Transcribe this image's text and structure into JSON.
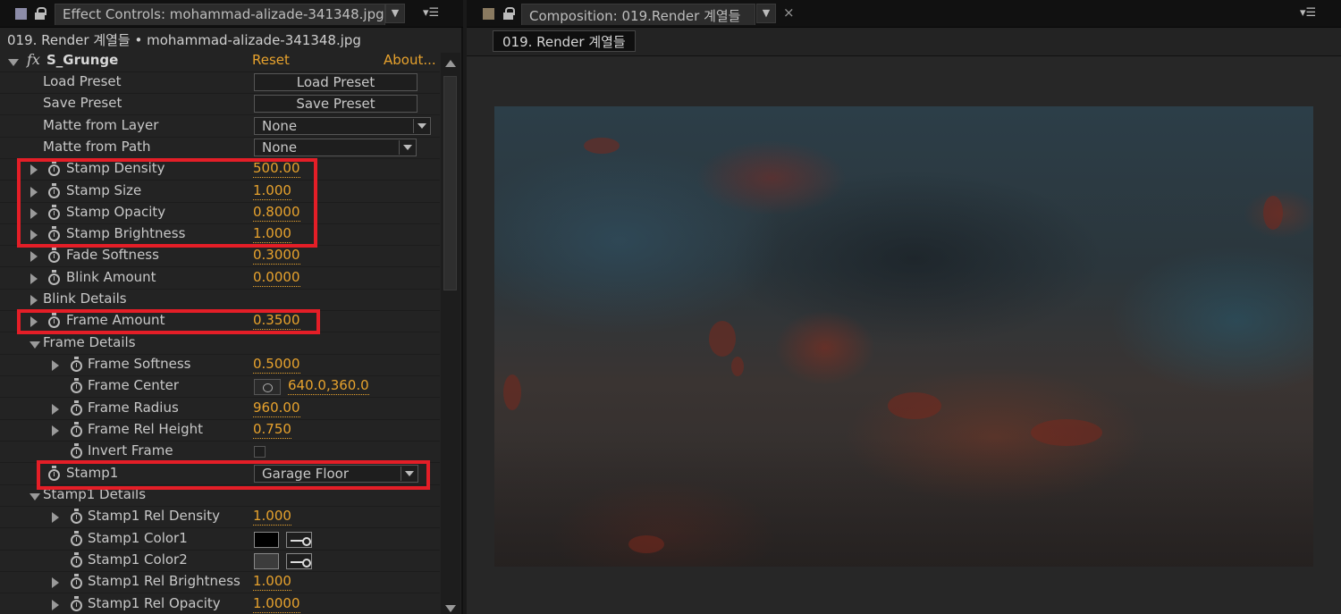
{
  "left_panel": {
    "tab_title": "Effect Controls: mohammad-alizade-341348.jpg",
    "layer_path": "019. Render 계열들 • mohammad-alizade-341348.jpg",
    "effect": {
      "name": "S_Grunge",
      "reset": "Reset",
      "about": "About..."
    },
    "rows": {
      "load_preset": {
        "label": "Load Preset",
        "button": "Load Preset"
      },
      "save_preset": {
        "label": "Save Preset",
        "button": "Save Preset"
      },
      "matte_from_layer": {
        "label": "Matte from Layer",
        "value": "None"
      },
      "matte_from_path": {
        "label": "Matte from Path",
        "value": "None"
      },
      "stamp_density": {
        "label": "Stamp Density",
        "value": "500.00"
      },
      "stamp_size": {
        "label": "Stamp Size",
        "value": "1.000"
      },
      "stamp_opacity": {
        "label": "Stamp Opacity",
        "value": "0.8000"
      },
      "stamp_brightness": {
        "label": "Stamp Brightness",
        "value": "1.000"
      },
      "fade_softness": {
        "label": "Fade Softness",
        "value": "0.3000"
      },
      "blink_amount": {
        "label": "Blink Amount",
        "value": "0.0000"
      },
      "blink_details": {
        "label": "Blink Details"
      },
      "frame_amount": {
        "label": "Frame Amount",
        "value": "0.3500"
      },
      "frame_details": {
        "label": "Frame Details"
      },
      "frame_softness": {
        "label": "Frame Softness",
        "value": "0.5000"
      },
      "frame_center": {
        "label": "Frame Center",
        "value": "640.0,360.0"
      },
      "frame_radius": {
        "label": "Frame Radius",
        "value": "960.00"
      },
      "frame_rel_height": {
        "label": "Frame Rel Height",
        "value": "0.750"
      },
      "invert_frame": {
        "label": "Invert Frame",
        "checked": false
      },
      "stamp1": {
        "label": "Stamp1",
        "value": "Garage Floor"
      },
      "stamp1_details": {
        "label": "Stamp1 Details"
      },
      "stamp1_rel_density": {
        "label": "Stamp1 Rel Density",
        "value": "1.000"
      },
      "stamp1_color1": {
        "label": "Stamp1 Color1",
        "color": "#000000"
      },
      "stamp1_color2": {
        "label": "Stamp1 Color2",
        "color": "#3c3c3c"
      },
      "stamp1_rel_brightness": {
        "label": "Stamp1 Rel Brightness",
        "value": "1.000"
      },
      "stamp1_rel_opacity": {
        "label": "Stamp1 Rel Opacity",
        "value": "1.0000"
      }
    }
  },
  "right_panel": {
    "tab_title": "Composition: 019.Render 계열들",
    "comp_subtab": "019. Render 계열들"
  },
  "colors": {
    "accent_value": "#e7a22d",
    "highlight_box": "#e41e27",
    "panel_bg": "#232323"
  }
}
